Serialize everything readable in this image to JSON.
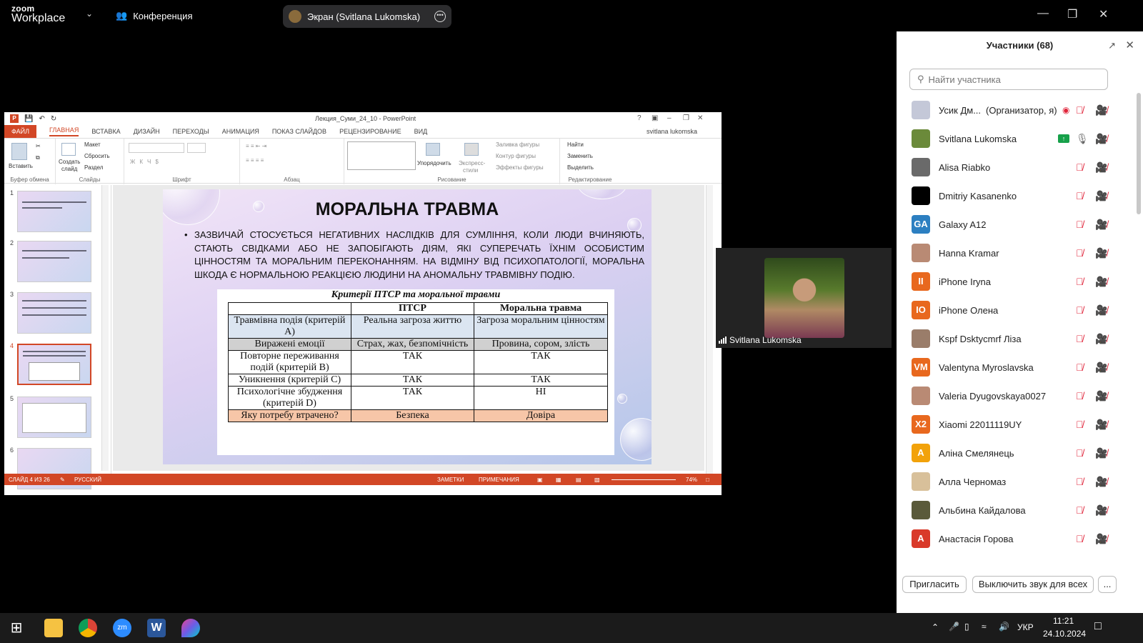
{
  "app": {
    "logo_line1": "zoom",
    "logo_line2": "Workplace",
    "meeting_label": "Конференция",
    "share_pill": "Экран (Svitlana Lukomska)"
  },
  "ppt": {
    "doc_title": "Лекция_Суми_24_10 - PowerPoint",
    "user": "svitlana lukomska",
    "tabs": [
      "ФАЙЛ",
      "ГЛАВНАЯ",
      "ВСТАВКА",
      "ДИЗАЙН",
      "ПЕРЕХОДЫ",
      "АНИМАЦИЯ",
      "ПОКАЗ СЛАЙДОВ",
      "РЕЦЕНЗИРОВАНИЕ",
      "ВИД"
    ],
    "ribbon": {
      "paste": "Вставить",
      "clipboard": "Буфер обмена",
      "layout": "Макет",
      "reset": "Сбросить",
      "new_slide_1": "Создать",
      "new_slide_2": "слайд",
      "section": "Раздел",
      "slides": "Слайды",
      "font": "Шрифт",
      "paragraph": "Абзац",
      "arrange": "Упорядочить",
      "quick_styles_1": "Экспресс-",
      "quick_styles_2": "стили",
      "shape_fill": "Заливка фигуры",
      "shape_outline": "Контур фигуры",
      "shape_effects": "Эффекты фигуры",
      "drawing": "Рисование",
      "find": "Найти",
      "replace": "Заменить",
      "select": "Выделить",
      "editing": "Редактирование"
    },
    "thumb_numbers": [
      "1",
      "2",
      "3",
      "4",
      "5",
      "6"
    ],
    "status": {
      "slide_of": "СЛАЙД 4 ИЗ 26",
      "language": "РУССКИЙ",
      "notes": "ЗАМЕТКИ",
      "comments": "ПРИМЕЧАНИЯ",
      "zoom": "74%"
    }
  },
  "slide": {
    "title": "МОРАЛЬНА ТРАВМА",
    "paragraph": "Зазвичай стосується негативних наслідків для сумління, коли люди вчиняють, стають свідками або не запобігають діям, які суперечать їхнім особистим цінностям та моральним переконанням. На відміну від психопатології, моральна шкода є нормальною реакцією людини на аномальну травмівну подію.",
    "table_caption": "Критерії ПТСР та моральної травми",
    "headers": [
      "",
      "ПТСР",
      "Моральна травма"
    ],
    "rows": [
      [
        "Травмівна подія (критерій А)",
        "Реальна загроза життю",
        "Загроза моральним цінностям"
      ],
      [
        "Виражені емоції",
        "Страх, жах, безпомічність",
        "Провина, сором, злість"
      ],
      [
        "Повторне переживання подій (критерій В)",
        "ТАК",
        "ТАК"
      ],
      [
        "Уникнення (критерій С)",
        "ТАК",
        "ТАК"
      ],
      [
        "Психологічне збудження (критерій D)",
        "ТАК",
        "НІ"
      ],
      [
        "Яку потребу втрачено?",
        "Безпека",
        "Довіра"
      ]
    ]
  },
  "video": {
    "name": "Svitlana Lukomska"
  },
  "participants": {
    "title": "Участники (68)",
    "search_placeholder": "Найти участника",
    "list": [
      {
        "name": "Усик Дм...",
        "role": "(Организатор, я)",
        "initials": "",
        "color": "#c4c8d8"
      },
      {
        "name": "Svitlana Lukomska",
        "initials": "",
        "color": "#6b8a3a"
      },
      {
        "name": "Alisa Riabko",
        "initials": "",
        "color": "#6a6a6a"
      },
      {
        "name": "Dmitriy Kasanenko",
        "initials": "",
        "color": "#000000"
      },
      {
        "name": "Galaxy A12",
        "initials": "GA",
        "color": "#2c7fc1"
      },
      {
        "name": "Hanna Kramar",
        "initials": "",
        "color": "#b98a74"
      },
      {
        "name": "iPhone Iryna",
        "initials": "II",
        "color": "#e8681e"
      },
      {
        "name": "iPhone Олена",
        "initials": "IO",
        "color": "#e8681e"
      },
      {
        "name": "Kspf Dsktycmrf Ліза",
        "initials": "",
        "color": "#9a7d6a"
      },
      {
        "name": "Valentyna Myroslavska",
        "initials": "VM",
        "color": "#e8681e"
      },
      {
        "name": "Valeria Dyugovskaya0027",
        "initials": "",
        "color": "#b98a74"
      },
      {
        "name": "Xiaomi 22011119UY",
        "initials": "X2",
        "color": "#e8681e"
      },
      {
        "name": "Аліна Смелянець",
        "initials": "A",
        "color": "#f2a20a"
      },
      {
        "name": "Алла Черномаз",
        "initials": "",
        "color": "#d8c09a"
      },
      {
        "name": "Альбина Кайдалова",
        "initials": "",
        "color": "#5a5a3a"
      },
      {
        "name": "Анастасія Горова",
        "initials": "A",
        "color": "#d93a2a"
      }
    ],
    "invite": "Пригласить",
    "mute_all": "Выключить звук для всех",
    "more": "..."
  },
  "taskbar": {
    "lang": "УКР",
    "time": "11:21",
    "date": "24.10.2024"
  }
}
